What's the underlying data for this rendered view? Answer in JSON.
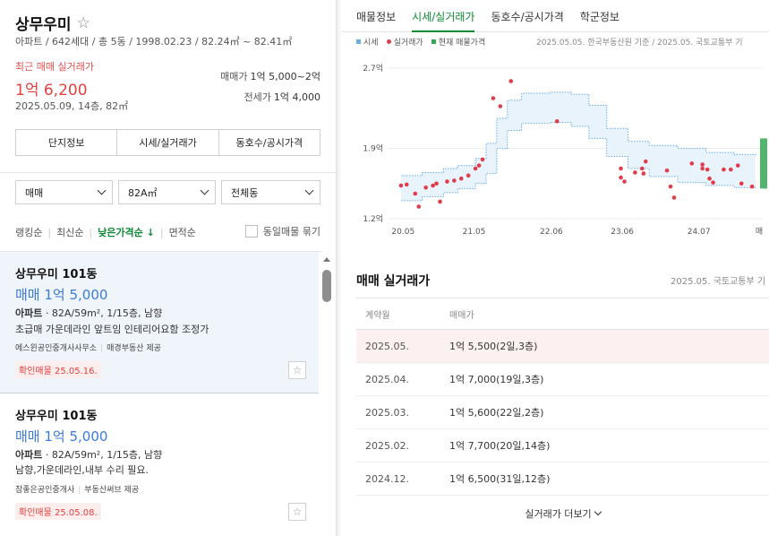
{
  "complex": {
    "name": "상무우미",
    "info": "아파트 / 642세대 / 총 5동 / 1998.02.23 / 82.24㎡ ~ 82.41㎡",
    "recent_label": "최근 매매 실거래가",
    "recent_price": "1억 6,200",
    "recent_date": "2025.05.09, 14층, 82㎡",
    "sale_label": "매매가",
    "sale_range": "1억 5,000~2억",
    "jeonse_label": "전세가",
    "jeonse_value": "1억 4,000"
  },
  "info_tabs": [
    "단지정보",
    "시세/실거래가",
    "동호수/공시가격"
  ],
  "filters": {
    "type": "매매",
    "area": "82A㎡",
    "dong": "전체동"
  },
  "sorts": {
    "items": [
      "랭킹순",
      "최신순"
    ],
    "active": "낮은가격순 ↓",
    "last": "면적순",
    "group_label": "동일매물 묶기"
  },
  "listings": [
    {
      "name": "상무우미 101동",
      "price": "매매 1억 5,000",
      "spec_type": "아파트",
      "spec_detail": " · 82A/59m², 1/15층, 남향",
      "desc": "초급매 가운데라인 앞트임 인테리어요함 조정가",
      "agent": "에스윈공인중개사사무소",
      "provider": "매경부동산 제공",
      "confirm": "확인매물 25.05.16."
    },
    {
      "name": "상무우미 101동",
      "price": "매매 1억 5,000",
      "spec_type": "아파트",
      "spec_detail": " · 82A/59m², 1/15층, 남향",
      "desc": "남향,가운데라인,내부 수리 필요.",
      "agent": "참좋은공인중개사",
      "provider": "부동산써브 제공",
      "confirm": "확인매물 25.05.08."
    }
  ],
  "right_tabs": {
    "items": [
      "매물정보",
      "시세/실거래가",
      "동호수/공시가격",
      "학군정보"
    ],
    "active_index": 1
  },
  "legend": {
    "market": "시세",
    "actual": "실거래가",
    "current": "현재 매물가격",
    "source": "2025.05.05. 한국부동산원 기준 / 2025.05. 국토교통부 기"
  },
  "colors": {
    "accent": "#0e8a36",
    "red": "#e44141",
    "blue": "#3a7bd5",
    "market_band": "#6aaee6",
    "dot": "#e03c4a",
    "current_bar": "#34a853"
  },
  "chart_data": {
    "type": "scatter",
    "y_ticks": [
      "2.7억",
      "1.9억",
      "1.2억"
    ],
    "y_tick_values": [
      2.7,
      1.9,
      1.2
    ],
    "x_ticks": [
      "20.05",
      "21.05",
      "22.06",
      "23.06",
      "24.07",
      "매"
    ],
    "x_tick_values": [
      2020.33,
      2021.33,
      2022.42,
      2023.42,
      2024.5,
      2025.35
    ],
    "ylim": [
      1.2,
      2.7
    ],
    "xlim": [
      2020.2,
      2025.4
    ],
    "series": [
      {
        "name": "실거래가",
        "points": [
          [
            2020.3,
            1.53
          ],
          [
            2020.38,
            1.54
          ],
          [
            2020.5,
            1.45
          ],
          [
            2020.55,
            1.32
          ],
          [
            2020.65,
            1.51
          ],
          [
            2020.75,
            1.53
          ],
          [
            2020.8,
            1.55
          ],
          [
            2020.85,
            1.37
          ],
          [
            2020.95,
            1.57
          ],
          [
            2021.05,
            1.58
          ],
          [
            2021.15,
            1.6
          ],
          [
            2021.25,
            1.63
          ],
          [
            2021.35,
            1.7
          ],
          [
            2021.4,
            1.73
          ],
          [
            2021.45,
            1.79
          ],
          [
            2021.6,
            2.4
          ],
          [
            2021.7,
            2.32
          ],
          [
            2021.85,
            2.57
          ],
          [
            2022.5,
            2.17
          ],
          [
            2023.4,
            1.7
          ],
          [
            2023.45,
            1.57
          ],
          [
            2023.4,
            1.61
          ],
          [
            2023.6,
            1.66
          ],
          [
            2023.7,
            1.7
          ],
          [
            2023.75,
            1.77
          ],
          [
            2023.72,
            1.65
          ],
          [
            2024.1,
            1.52
          ],
          [
            2024.05,
            1.68
          ],
          [
            2024.15,
            1.41
          ],
          [
            2024.4,
            1.75
          ],
          [
            2024.55,
            1.74
          ],
          [
            2024.55,
            1.7
          ],
          [
            2024.62,
            1.69
          ],
          [
            2024.65,
            1.6
          ],
          [
            2024.7,
            1.56
          ],
          [
            2024.85,
            1.69
          ],
          [
            2024.95,
            1.69
          ],
          [
            2025.05,
            1.73
          ],
          [
            2025.1,
            1.55
          ],
          [
            2025.25,
            1.52
          ]
        ]
      }
    ],
    "market_upper": [
      [
        2020.3,
        1.63
      ],
      [
        2020.6,
        1.66
      ],
      [
        2020.9,
        1.7
      ],
      [
        2021.1,
        1.73
      ],
      [
        2021.35,
        1.8
      ],
      [
        2021.5,
        1.95
      ],
      [
        2021.65,
        2.2
      ],
      [
        2021.8,
        2.38
      ],
      [
        2022.0,
        2.45
      ],
      [
        2022.4,
        2.46
      ],
      [
        2022.7,
        2.44
      ],
      [
        2022.95,
        2.33
      ],
      [
        2023.2,
        2.1
      ],
      [
        2023.5,
        1.97
      ],
      [
        2023.8,
        1.93
      ],
      [
        2024.2,
        1.9
      ],
      [
        2024.6,
        1.86
      ],
      [
        2025.0,
        1.84
      ],
      [
        2025.3,
        1.83
      ]
    ],
    "market_lower": [
      [
        2020.3,
        1.38
      ],
      [
        2020.6,
        1.42
      ],
      [
        2020.9,
        1.46
      ],
      [
        2021.1,
        1.5
      ],
      [
        2021.35,
        1.55
      ],
      [
        2021.5,
        1.65
      ],
      [
        2021.65,
        1.9
      ],
      [
        2021.8,
        2.08
      ],
      [
        2022.0,
        2.15
      ],
      [
        2022.4,
        2.16
      ],
      [
        2022.7,
        2.12
      ],
      [
        2022.95,
        2.0
      ],
      [
        2023.2,
        1.82
      ],
      [
        2023.5,
        1.7
      ],
      [
        2023.8,
        1.62
      ],
      [
        2024.2,
        1.56
      ],
      [
        2024.6,
        1.53
      ],
      [
        2025.0,
        1.51
      ],
      [
        2025.3,
        1.5
      ]
    ],
    "current_price_range": [
      1.5,
      2.0
    ]
  },
  "deals": {
    "title": "매매 실거래가",
    "source": "2025.05. 국토교통부 기",
    "head_date": "계약월",
    "head_price": "매매가",
    "rows": [
      {
        "date": "2025.05.",
        "price": "1억 5,500(2일,3층)"
      },
      {
        "date": "2025.04.",
        "price": "1억 7,000(19일,3층)"
      },
      {
        "date": "2025.03.",
        "price": "1억 5,600(22일,2층)"
      },
      {
        "date": "2025.02.",
        "price": "1억 7,700(20일,14층)"
      },
      {
        "date": "2024.12.",
        "price": "1억 6,500(31일,12층)"
      }
    ],
    "more": "실거래가 더보기"
  }
}
